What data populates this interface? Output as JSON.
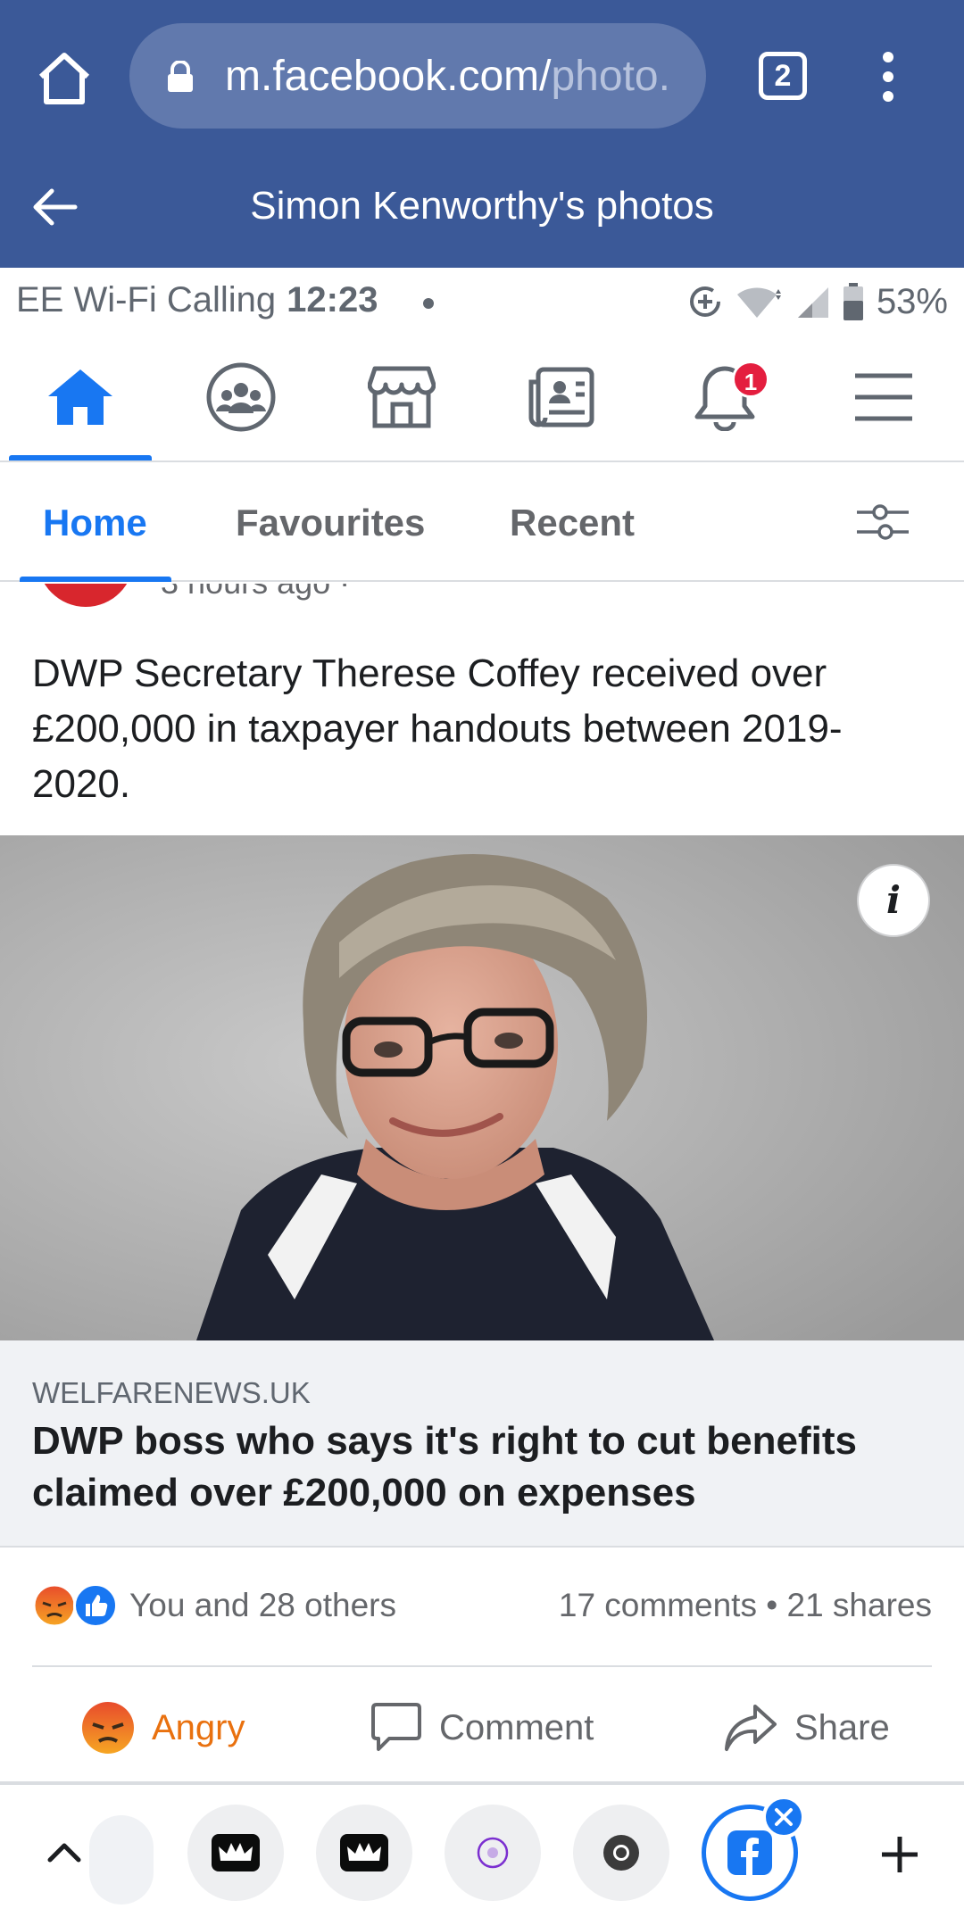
{
  "browser": {
    "url_host": "m.facebook.com/",
    "url_path": "photo.",
    "tab_count": "2",
    "page_title": "Simon Kenworthy's photos"
  },
  "status_bar": {
    "carrier": "EE Wi-Fi Calling",
    "time": "12:23",
    "battery": "53%"
  },
  "fb_nav": {
    "items": [
      {
        "icon": "home-icon",
        "active": true
      },
      {
        "icon": "groups-icon"
      },
      {
        "icon": "marketplace-icon"
      },
      {
        "icon": "news-feed-icon"
      },
      {
        "icon": "notifications-icon",
        "badge": "1"
      },
      {
        "icon": "menu-icon"
      }
    ]
  },
  "sub_tabs": {
    "items": [
      "Home",
      "Favourites",
      "Recent"
    ],
    "active": "Home"
  },
  "post": {
    "meta_partial": "3 hours ago ·",
    "text": "DWP Secretary Therese Coffey received over £200,000 in taxpayer handouts between 2019-2020.",
    "link_domain": "WELFARENEWS.UK",
    "link_title": "DWP boss who says it's right to cut benefits claimed over £200,000 on expenses",
    "reactions_text": "You and 28 others",
    "comments": "17 comments",
    "shares": "21 shares",
    "stats_separator": "•"
  },
  "actions": {
    "angry": "Angry",
    "comment": "Comment",
    "share": "Share"
  },
  "colors": {
    "browser_blue": "#3b5998",
    "fb_blue": "#1877f2",
    "angry_orange": "#e9710f",
    "badge_red": "#e41e3f"
  }
}
